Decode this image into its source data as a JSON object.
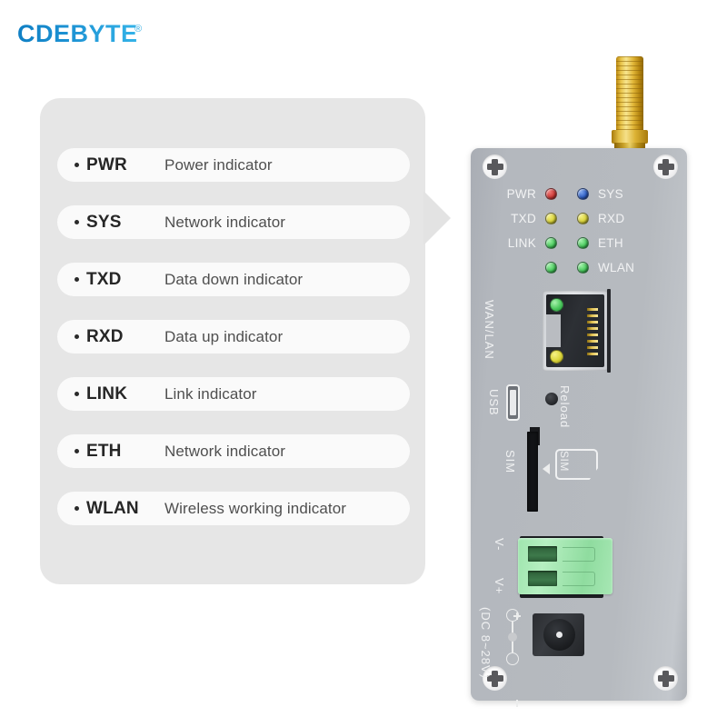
{
  "brand": {
    "name": "CDEBYTE",
    "registered_mark": "®"
  },
  "legend": {
    "items": [
      {
        "label": "PWR",
        "desc": "Power indicator"
      },
      {
        "label": "SYS",
        "desc": "Network indicator"
      },
      {
        "label": "TXD",
        "desc": "Data down indicator"
      },
      {
        "label": "RXD",
        "desc": "Data up indicator"
      },
      {
        "label": "LINK",
        "desc": "Link indicator"
      },
      {
        "label": "ETH",
        "desc": "Network indicator"
      },
      {
        "label": "WLAN",
        "desc": "Wireless working indicator"
      }
    ]
  },
  "device": {
    "led_rows": [
      {
        "left_label": "PWR",
        "left_color": "#cc3a37",
        "right_color": "#2f5fc4",
        "right_label": "SYS"
      },
      {
        "left_label": "TXD",
        "left_color": "#d8d23a",
        "right_color": "#d8d23a",
        "right_label": "RXD"
      },
      {
        "left_label": "LINK",
        "left_color": "#49c95d",
        "right_color": "#49c95d",
        "right_label": "ETH"
      },
      {
        "left_label": "",
        "left_color": "#49c95d",
        "right_color": "#49c95d",
        "right_label": "WLAN"
      }
    ],
    "ports": {
      "ethernet_label": "WAN/LAN",
      "usb_label": "USB",
      "reload_label": "Reload",
      "sim_slot_label": "SIM",
      "sim_card_label": "SIM",
      "terminal_negative_label": "V-",
      "terminal_positive_label": "V+",
      "power_spec_label": "(DC 8~28V)"
    },
    "colors": {
      "body": "#b4b8be",
      "terminal_block": "#9fe5ae",
      "antenna_connector": "#e2b738"
    }
  }
}
